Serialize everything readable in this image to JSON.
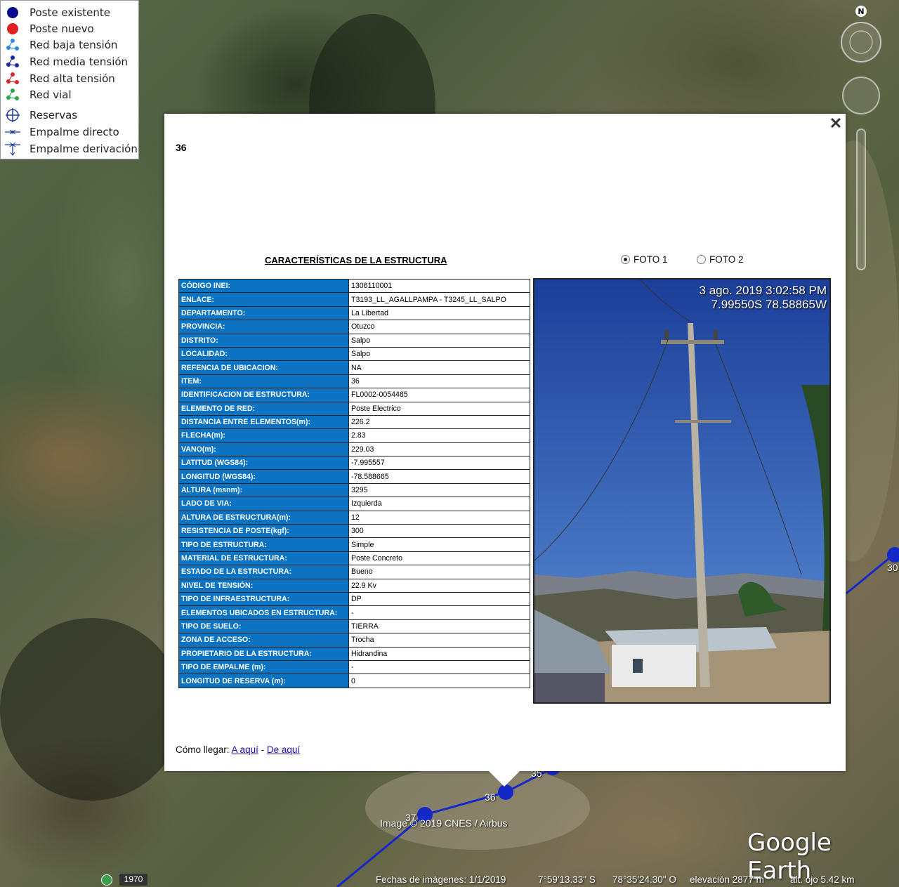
{
  "legend": {
    "items": [
      {
        "label": "Poste existente",
        "icon": "blue-dot-icon"
      },
      {
        "label": "Poste nuevo",
        "icon": "red-dot-icon"
      },
      {
        "label": "Red baja tensión",
        "icon": "low-voltage-network-icon"
      },
      {
        "label": "Red media tensión",
        "icon": "medium-voltage-network-icon"
      },
      {
        "label": "Red alta tensión",
        "icon": "high-voltage-network-icon"
      },
      {
        "label": "Red vial",
        "icon": "road-network-icon"
      },
      {
        "label": "Reservas",
        "icon": "crosshair-icon"
      },
      {
        "label": "Empalme directo",
        "icon": "direct-splice-icon"
      },
      {
        "label": "Empalme derivación",
        "icon": "branch-splice-icon"
      }
    ],
    "colors": {
      "existing": "#0a0a8c",
      "new": "#e02020",
      "low": "#2a8fd6",
      "medium": "#1c2aa0",
      "high": "#d42a2a",
      "road": "#2aa84a"
    }
  },
  "nav": {
    "north_label": "N"
  },
  "popup": {
    "title": "36",
    "close_glyph": "✕",
    "section_title": "CARACTERÍSTICAS DE LA ESTRUCTURA",
    "photo_options": [
      {
        "label": "FOTO 1",
        "selected": true
      },
      {
        "label": "FOTO 2",
        "selected": false
      }
    ],
    "table": [
      {
        "key": "CÓDIGO INEI:",
        "value": "1306110001"
      },
      {
        "key": "ENLACE:",
        "value": "T3193_LL_AGALLPAMPA - T3245_LL_SALPO"
      },
      {
        "key": "DEPARTAMENTO:",
        "value": "La Libertad"
      },
      {
        "key": "PROVINCIA:",
        "value": "Otuzco"
      },
      {
        "key": "DISTRITO:",
        "value": "Salpo"
      },
      {
        "key": "LOCALIDAD:",
        "value": "Salpo"
      },
      {
        "key": "REFENCIA DE UBICACION:",
        "value": "NA"
      },
      {
        "key": "ITEM:",
        "value": "36"
      },
      {
        "key": "IDENTIFICACION DE ESTRUCTURA:",
        "value": "FL0002-0054485"
      },
      {
        "key": "ELEMENTO DE RED:",
        "value": "Poste Electrico"
      },
      {
        "key": "DISTANCIA ENTRE ELEMENTOS(m):",
        "value": "226.2"
      },
      {
        "key": "FLECHA(m):",
        "value": "2.83"
      },
      {
        "key": "VANO(m):",
        "value": "229.03"
      },
      {
        "key": "LATITUD (WGS84):",
        "value": "-7.995557"
      },
      {
        "key": "LONGITUD (WGS84):",
        "value": "-78.588665"
      },
      {
        "key": "ALTURA (msnm):",
        "value": "3295"
      },
      {
        "key": "LADO DE VIA:",
        "value": "Izquierda"
      },
      {
        "key": "ALTURA DE ESTRUCTURA(m):",
        "value": "12"
      },
      {
        "key": "RESISTENCIA DE POSTE(kgf):",
        "value": "300"
      },
      {
        "key": "TIPO DE ESTRUCTURA:",
        "value": "Simple"
      },
      {
        "key": "MATERIAL DE ESTRUCTURA:",
        "value": "Poste Concreto"
      },
      {
        "key": "ESTADO DE LA ESTRUCTURA:",
        "value": "Bueno"
      },
      {
        "key": "NIVEL DE TENSIÓN:",
        "value": "22.9 Kv"
      },
      {
        "key": "TIPO DE INFRAESTRUCTURA:",
        "value": "DP"
      },
      {
        "key": "ELEMENTOS UBICADOS EN ESTRUCTURA:",
        "value": "-"
      },
      {
        "key": "TIPO DE SUELO:",
        "value": "TIERRA"
      },
      {
        "key": "ZONA DE ACCESO:",
        "value": "Trocha"
      },
      {
        "key": "PROPIETARIO DE LA ESTRUCTURA:",
        "value": "Hidrandina"
      },
      {
        "key": "TIPO DE EMPALME (m):",
        "value": "-"
      },
      {
        "key": "LONGITUD DE RESERVA (m):",
        "value": "0"
      }
    ],
    "photo": {
      "stamp_line1": "3 ago. 2019 3:02:58 PM",
      "stamp_line2": "7.99550S 78.58865W"
    },
    "directions": {
      "label": "Cómo llegar: ",
      "link_to": "A aquí",
      "separator": " - ",
      "link_from": "De aquí"
    }
  },
  "map": {
    "labels": {
      "pole_35": "35",
      "pole_36": "36",
      "pole_37": "37",
      "pole_30": "30"
    },
    "credit": "Image © 2019 CNES / Airbus",
    "logo": "Google Earth",
    "line_color": "#1428c8"
  },
  "status": {
    "year": "1970",
    "imagery_date": "Fechas de imágenes: 1/1/2019",
    "lat": "7°59'13.33\" S",
    "lon": "78°35'24.30\" O",
    "elevation": "elevación  2877 m",
    "eye_alt": "alt. ojo   5.42 km"
  }
}
